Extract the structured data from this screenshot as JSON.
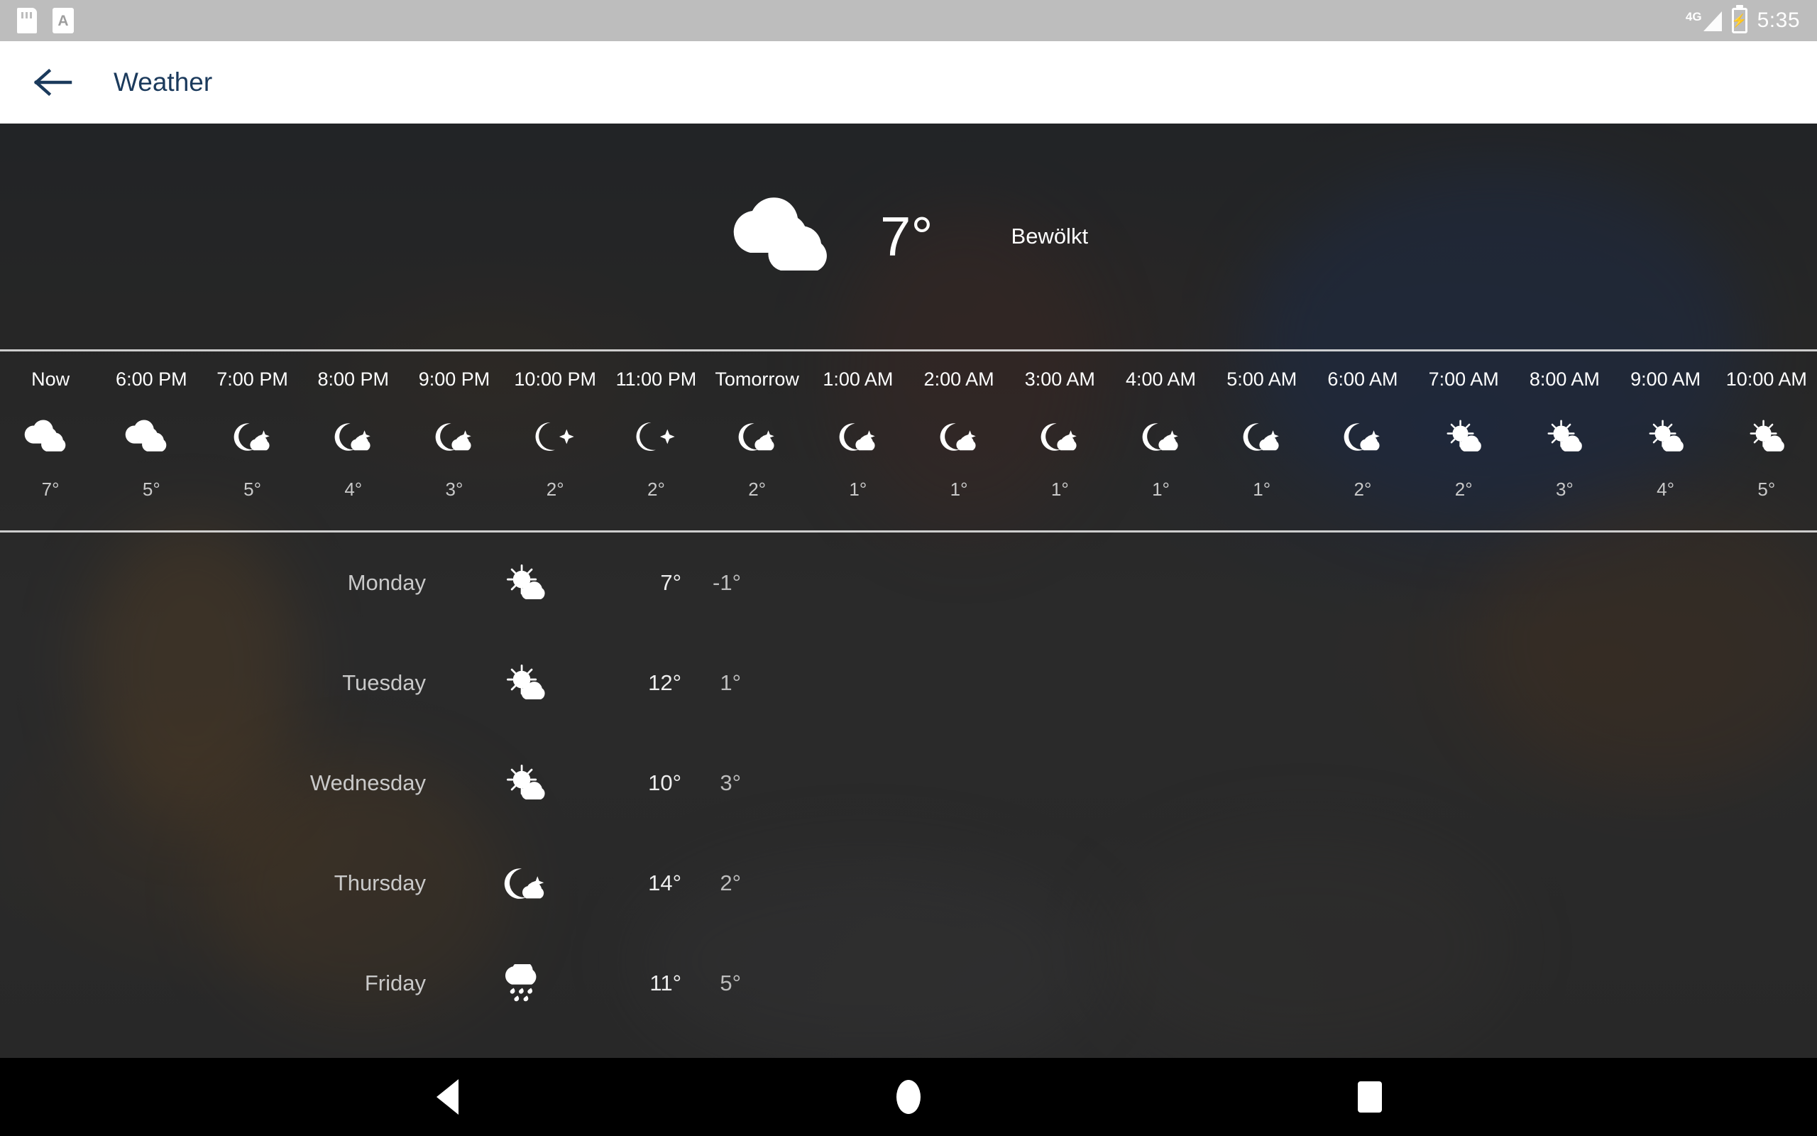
{
  "status_bar": {
    "icons": [
      "sd-card-icon",
      "a-document-icon"
    ],
    "network_label": "4G",
    "battery_glyph": "⚡",
    "time": "5:35"
  },
  "app_bar": {
    "back_icon": "arrow-left-icon",
    "title": "Weather",
    "title_color": "#1b3a5c"
  },
  "current": {
    "icon": "cloudy-icon",
    "temperature": "7°",
    "condition": "Bewölkt"
  },
  "hourly": [
    {
      "label": "Now",
      "icon": "cloudy-icon",
      "temp": "7°"
    },
    {
      "label": "6:00 PM",
      "icon": "cloudy-icon",
      "temp": "5°"
    },
    {
      "label": "7:00 PM",
      "icon": "night-cloud-icon",
      "temp": "5°"
    },
    {
      "label": "8:00 PM",
      "icon": "night-cloud-icon",
      "temp": "4°"
    },
    {
      "label": "9:00 PM",
      "icon": "night-cloud-icon",
      "temp": "3°"
    },
    {
      "label": "10:00 PM",
      "icon": "night-clear-icon",
      "temp": "2°"
    },
    {
      "label": "11:00 PM",
      "icon": "night-clear-icon",
      "temp": "2°"
    },
    {
      "label": "Tomorrow",
      "icon": "night-cloud-icon",
      "temp": "2°"
    },
    {
      "label": "1:00 AM",
      "icon": "night-cloud-icon",
      "temp": "1°"
    },
    {
      "label": "2:00 AM",
      "icon": "night-cloud-icon",
      "temp": "1°"
    },
    {
      "label": "3:00 AM",
      "icon": "night-cloud-icon",
      "temp": "1°"
    },
    {
      "label": "4:00 AM",
      "icon": "night-cloud-icon",
      "temp": "1°"
    },
    {
      "label": "5:00 AM",
      "icon": "night-cloud-icon",
      "temp": "1°"
    },
    {
      "label": "6:00 AM",
      "icon": "night-cloud-icon",
      "temp": "2°"
    },
    {
      "label": "7:00 AM",
      "icon": "sun-cloud-icon",
      "temp": "2°"
    },
    {
      "label": "8:00 AM",
      "icon": "sun-cloud-icon",
      "temp": "3°"
    },
    {
      "label": "9:00 AM",
      "icon": "sun-cloud-icon",
      "temp": "4°"
    },
    {
      "label": "10:00 AM",
      "icon": "sun-cloud-icon",
      "temp": "5°"
    }
  ],
  "daily": [
    {
      "day": "Monday",
      "icon": "sun-cloud-icon",
      "high": "7°",
      "low": "-1°"
    },
    {
      "day": "Tuesday",
      "icon": "sun-cloud-icon",
      "high": "12°",
      "low": "1°"
    },
    {
      "day": "Wednesday",
      "icon": "sun-cloud-icon",
      "high": "10°",
      "low": "3°"
    },
    {
      "day": "Thursday",
      "icon": "night-cloud-icon",
      "high": "14°",
      "low": "2°"
    },
    {
      "day": "Friday",
      "icon": "rain-icon",
      "high": "11°",
      "low": "5°"
    }
  ],
  "nav_bar": {
    "back_label": "back-triangle-icon",
    "home_label": "home-circle-icon",
    "recents_label": "recents-square-icon"
  }
}
